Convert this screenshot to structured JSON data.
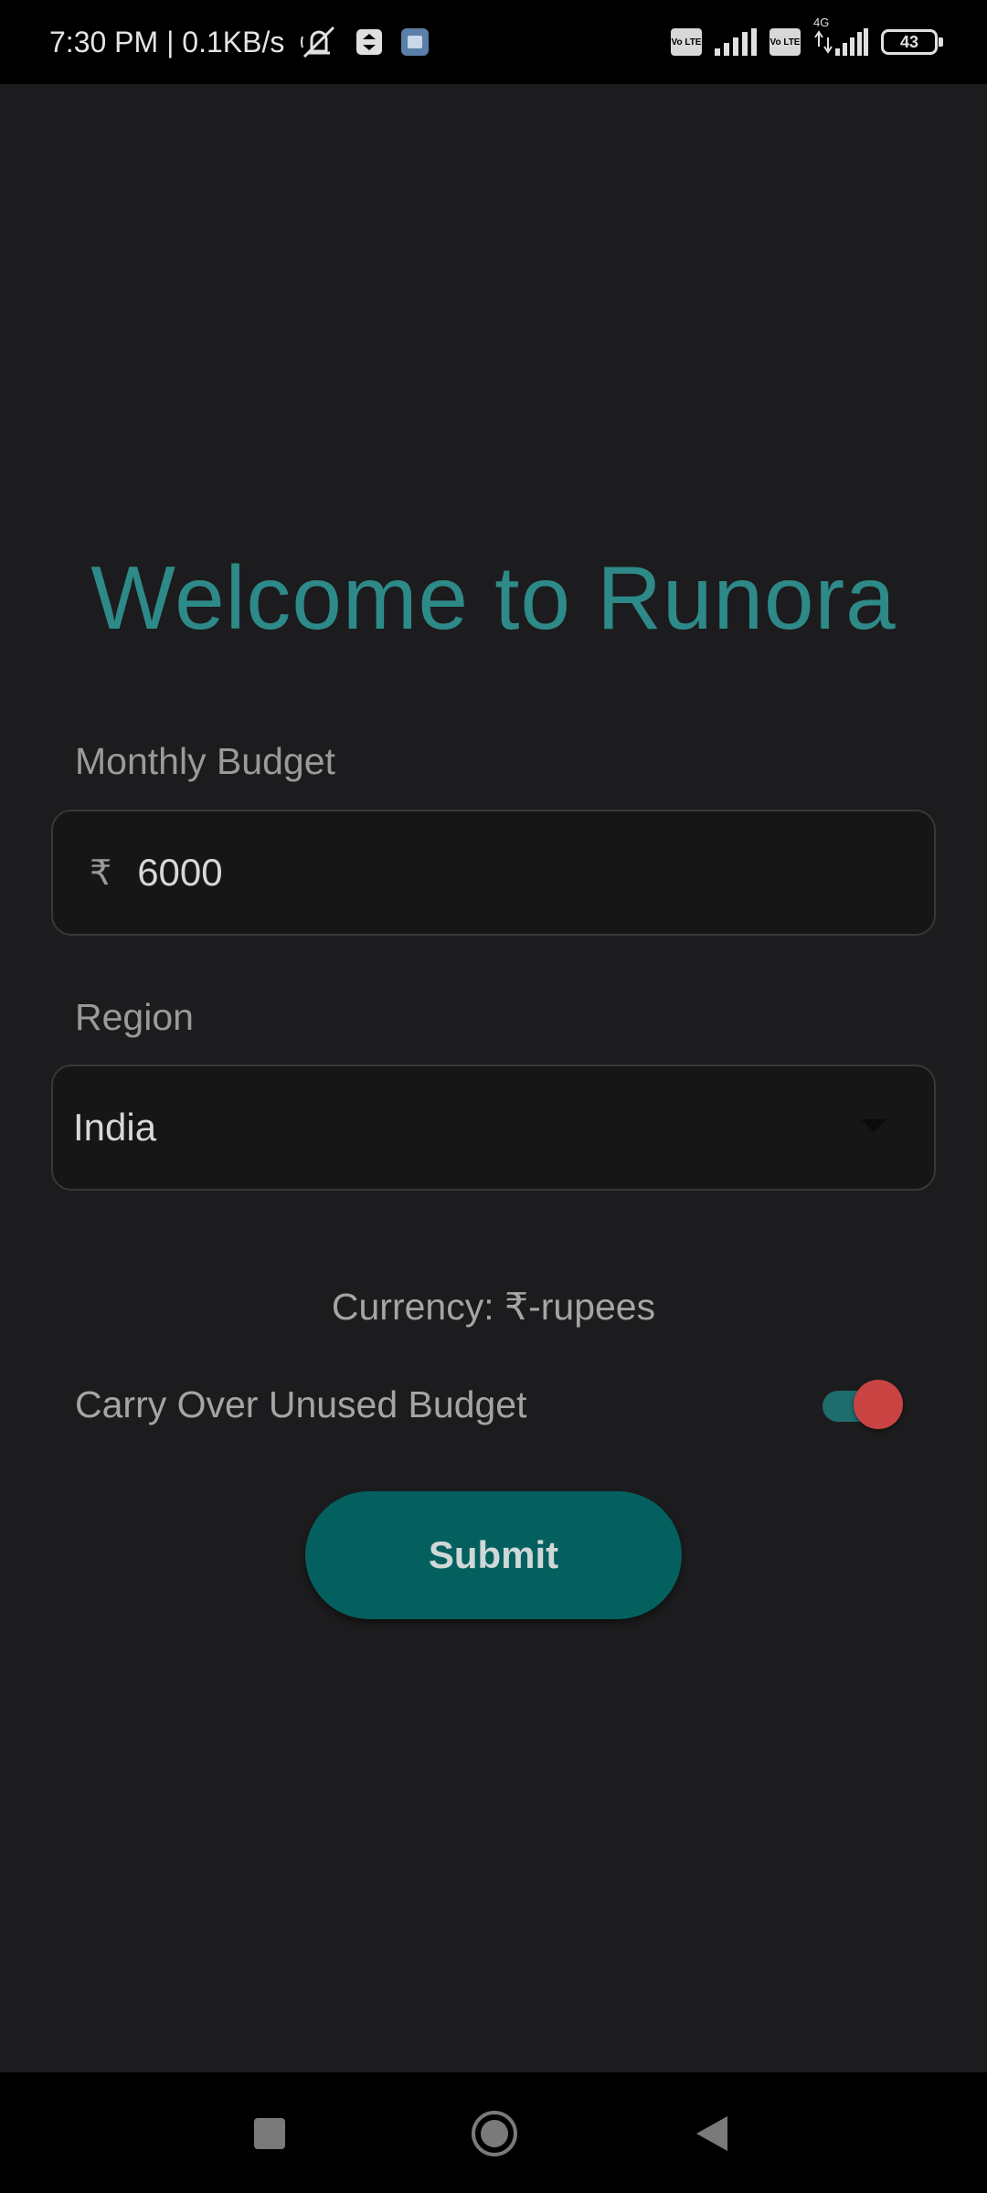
{
  "status_bar": {
    "time_network": "7:30 PM | 0.1KB/s",
    "network_type": "4G",
    "volte": "Vo LTE",
    "battery": "43"
  },
  "page": {
    "title": "Welcome to Runora"
  },
  "budget": {
    "label": "Monthly Budget",
    "prefix": "₹",
    "value": "6000"
  },
  "region": {
    "label": "Region",
    "selected": "India"
  },
  "currency": {
    "text": "Currency: ₹-rupees"
  },
  "carry_over": {
    "label": "Carry Over Unused Budget",
    "enabled": true
  },
  "submit": {
    "label": "Submit"
  },
  "colors": {
    "background": "#1c1c1e",
    "accent": "#2e8a88",
    "button": "#04605e",
    "toggle_thumb": "#c94343"
  }
}
